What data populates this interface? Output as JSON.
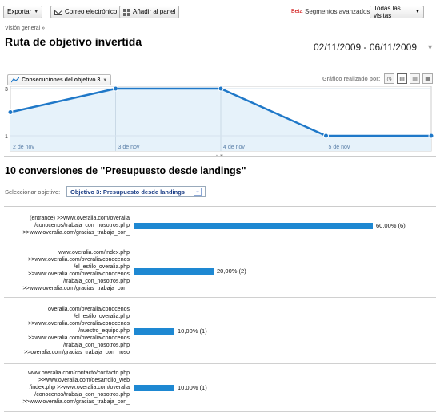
{
  "toolbar": {
    "export_label": "Exportar",
    "email_label": "Correo electrónico",
    "add_panel_label": "Añadir al panel",
    "beta": "Beta",
    "segments_label": "Segmentos avanzados:",
    "segments_value": "Todas las visitas"
  },
  "breadcrumb": "Visión general »",
  "page_title": "Ruta de objetivo invertida",
  "date_range": "02/11/2009 - 06/11/2009",
  "graph_header": {
    "metric": "Consecuciones del objetivo 3",
    "graph_by_label": "Gráfico realizado por:",
    "views": [
      "clock-icon",
      "day-view-icon",
      "week-view-icon",
      "month-view-icon"
    ]
  },
  "chart_data": {
    "type": "area",
    "x": [
      "2 de nov",
      "3 de nov",
      "4 de nov",
      "5 de nov",
      "6 de nov"
    ],
    "tick_labels": [
      "2 de nov",
      "3 de nov",
      "4 de nov",
      "5 de nov"
    ],
    "values": [
      2,
      3,
      3,
      1,
      1
    ],
    "y_tick_labels": [
      "3",
      "1"
    ],
    "ylim": [
      1,
      3
    ],
    "line_color": "#1f78c8",
    "fill_color": "#e6f2fa",
    "grid": true
  },
  "section_title": "10 conversiones de \"Presupuesto desde landings\"",
  "goal_select": {
    "label": "Seleccionar objetivo:",
    "value": "Objetivo 3: Presupuesto desde landings"
  },
  "paths": [
    {
      "lines": [
        "(entrance) >>www.overalia.com/overalia",
        "/conocenos/trabaja_con_nosotros.php",
        ">>www.overalia.com/gracias_trabaja_con_"
      ],
      "percent": 60,
      "label": "60,00% (6)"
    },
    {
      "lines": [
        "www.overalia.com/index.php",
        ">>www.overalia.com/overalia/conocenos",
        "/el_estilo_overalia.php",
        ">>www.overalia.com/overalia/conocenos",
        "/trabaja_con_nosotros.php",
        ">>www.overalia.com/gracias_trabaja_con_"
      ],
      "percent": 20,
      "label": "20,00% (2)"
    },
    {
      "lines": [
        "overalia.com/overalia/conocenos",
        "/el_estilo_overalia.php",
        ">>www.overalia.com/overalia/conocenos",
        "/nuestro_equipo.php",
        ">>www.overalia.com/overalia/conocenos",
        "/trabaja_con_nosotros.php",
        ">>overalia.com/gracias_trabaja_con_noso"
      ],
      "percent": 10,
      "label": "10,00% (1)"
    },
    {
      "lines": [
        "www.overalia.com/contacto/contacto.php",
        ">>www.overalia.com/desarrollo_web",
        "/index.php >>www.overalia.com/overalia",
        "/conocenos/trabaja_con_nosotros.php",
        ">>www.overalia.com/gracias_trabaja_con_"
      ],
      "percent": 10,
      "label": "10,00% (1)"
    }
  ],
  "colors": {
    "bar": "#1e88d2",
    "beta": "#cc0000",
    "link": "#1a3d85"
  }
}
